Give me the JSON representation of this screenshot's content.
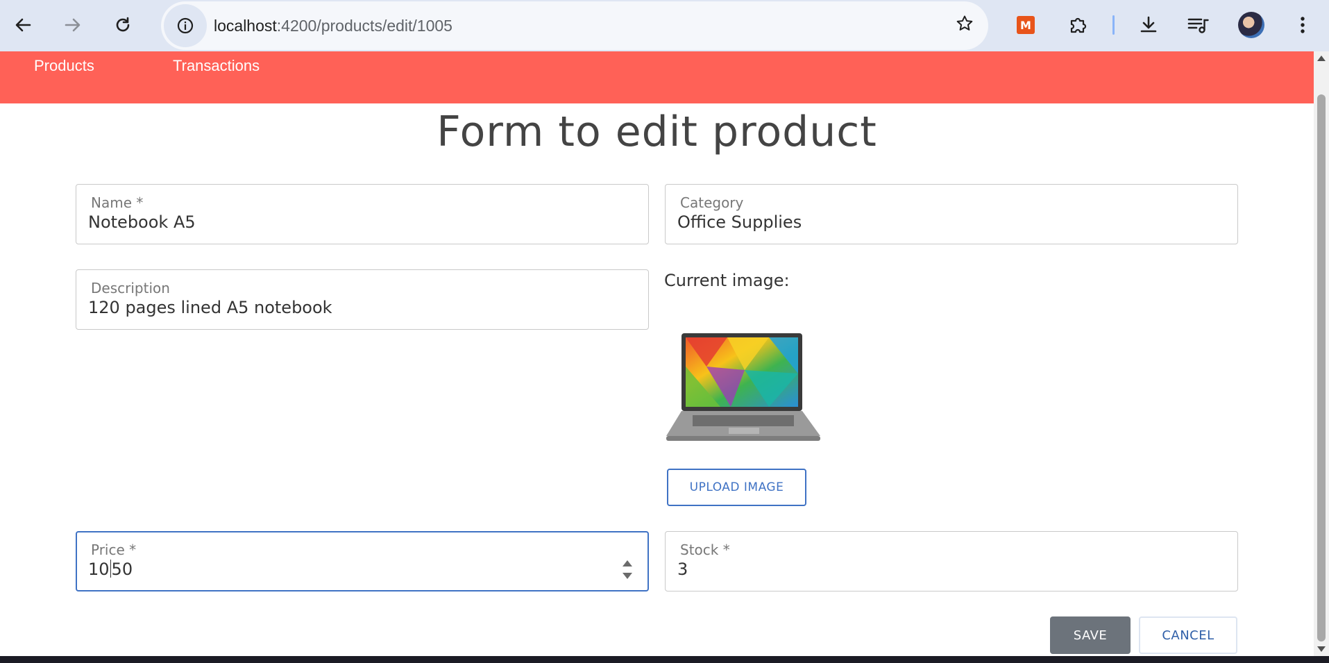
{
  "browser": {
    "url_host": "localhost",
    "url_rest": ":4200/products/edit/1005",
    "extension_label": "M"
  },
  "nav": {
    "products": "Products",
    "transactions": "Transactions"
  },
  "form": {
    "title": "Form to edit product",
    "name": {
      "label": "Name *",
      "value": "Notebook A5"
    },
    "category": {
      "label": "Category",
      "value": "Office Supplies"
    },
    "description": {
      "label": "Description",
      "value": "120 pages lined A5 notebook"
    },
    "current_image_label": "Current image:",
    "upload_button": "UPLOAD IMAGE",
    "price": {
      "label": "Price *",
      "value_before_cursor": "10",
      "value_after_cursor": "50"
    },
    "stock": {
      "label": "Stock *",
      "value": "3"
    },
    "save_button": "SAVE",
    "cancel_button": "CANCEL"
  },
  "colors": {
    "header": "#ff6157",
    "accent": "#3f72c4",
    "save": "#6c737b"
  }
}
